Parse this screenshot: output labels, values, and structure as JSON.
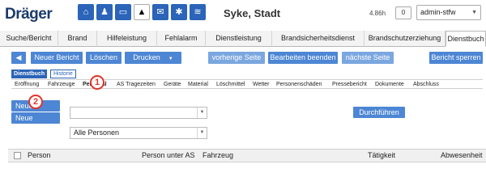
{
  "header": {
    "logo": "Dräger",
    "icons": [
      "home-icon",
      "person-icon",
      "vehicle-icon",
      "siren-icon",
      "mail-icon",
      "settings-icon",
      "layers-icon"
    ],
    "location": "Syke, Stadt",
    "version": "4.86h",
    "counter": "0",
    "user": "admin-stfw"
  },
  "tabs": [
    "Suche/Bericht",
    "Brand",
    "Hilfeleistung",
    "Fehlalarm",
    "Dienstleistung",
    "Brandsicherheitsdienst",
    "Brandschutzerziehung",
    "Dienstbuch"
  ],
  "active_tab": "Dienstbuch",
  "toolbar": {
    "back": "◀",
    "new_report": "Neuer Bericht",
    "delete": "Löschen",
    "print": "Drucken",
    "prev_page": "vorherige Seite",
    "finish_edit": "Bearbeiten beenden",
    "next_page": "nächste Seite",
    "lock_report": "Bericht sperren"
  },
  "subtabs": [
    "Dienstbuch",
    "Historie"
  ],
  "nav": [
    "Eröffnung",
    "Fahrzeuge",
    "Personal",
    "AS Tragezeiten",
    "Geräte",
    "Material",
    "Löschmittel",
    "Wetter",
    "Personenschäden",
    "Pressebericht",
    "Dokumente",
    "Abschluss"
  ],
  "form": {
    "new_entry": "Neuer Eintrag",
    "new_unit": "Neue Einheit",
    "select_empty": "",
    "persons_select": "Alle Personen",
    "execute": "Durchführen"
  },
  "table": {
    "columns": [
      "Person",
      "Person unter AS",
      "Fahrzeug",
      "Tätigkeit",
      "Abwesenheit"
    ]
  },
  "callouts": [
    "1",
    "2"
  ],
  "colors": {
    "accent": "#4d86d4",
    "dark_accent": "#2b64b8",
    "callout": "#e0352b"
  }
}
